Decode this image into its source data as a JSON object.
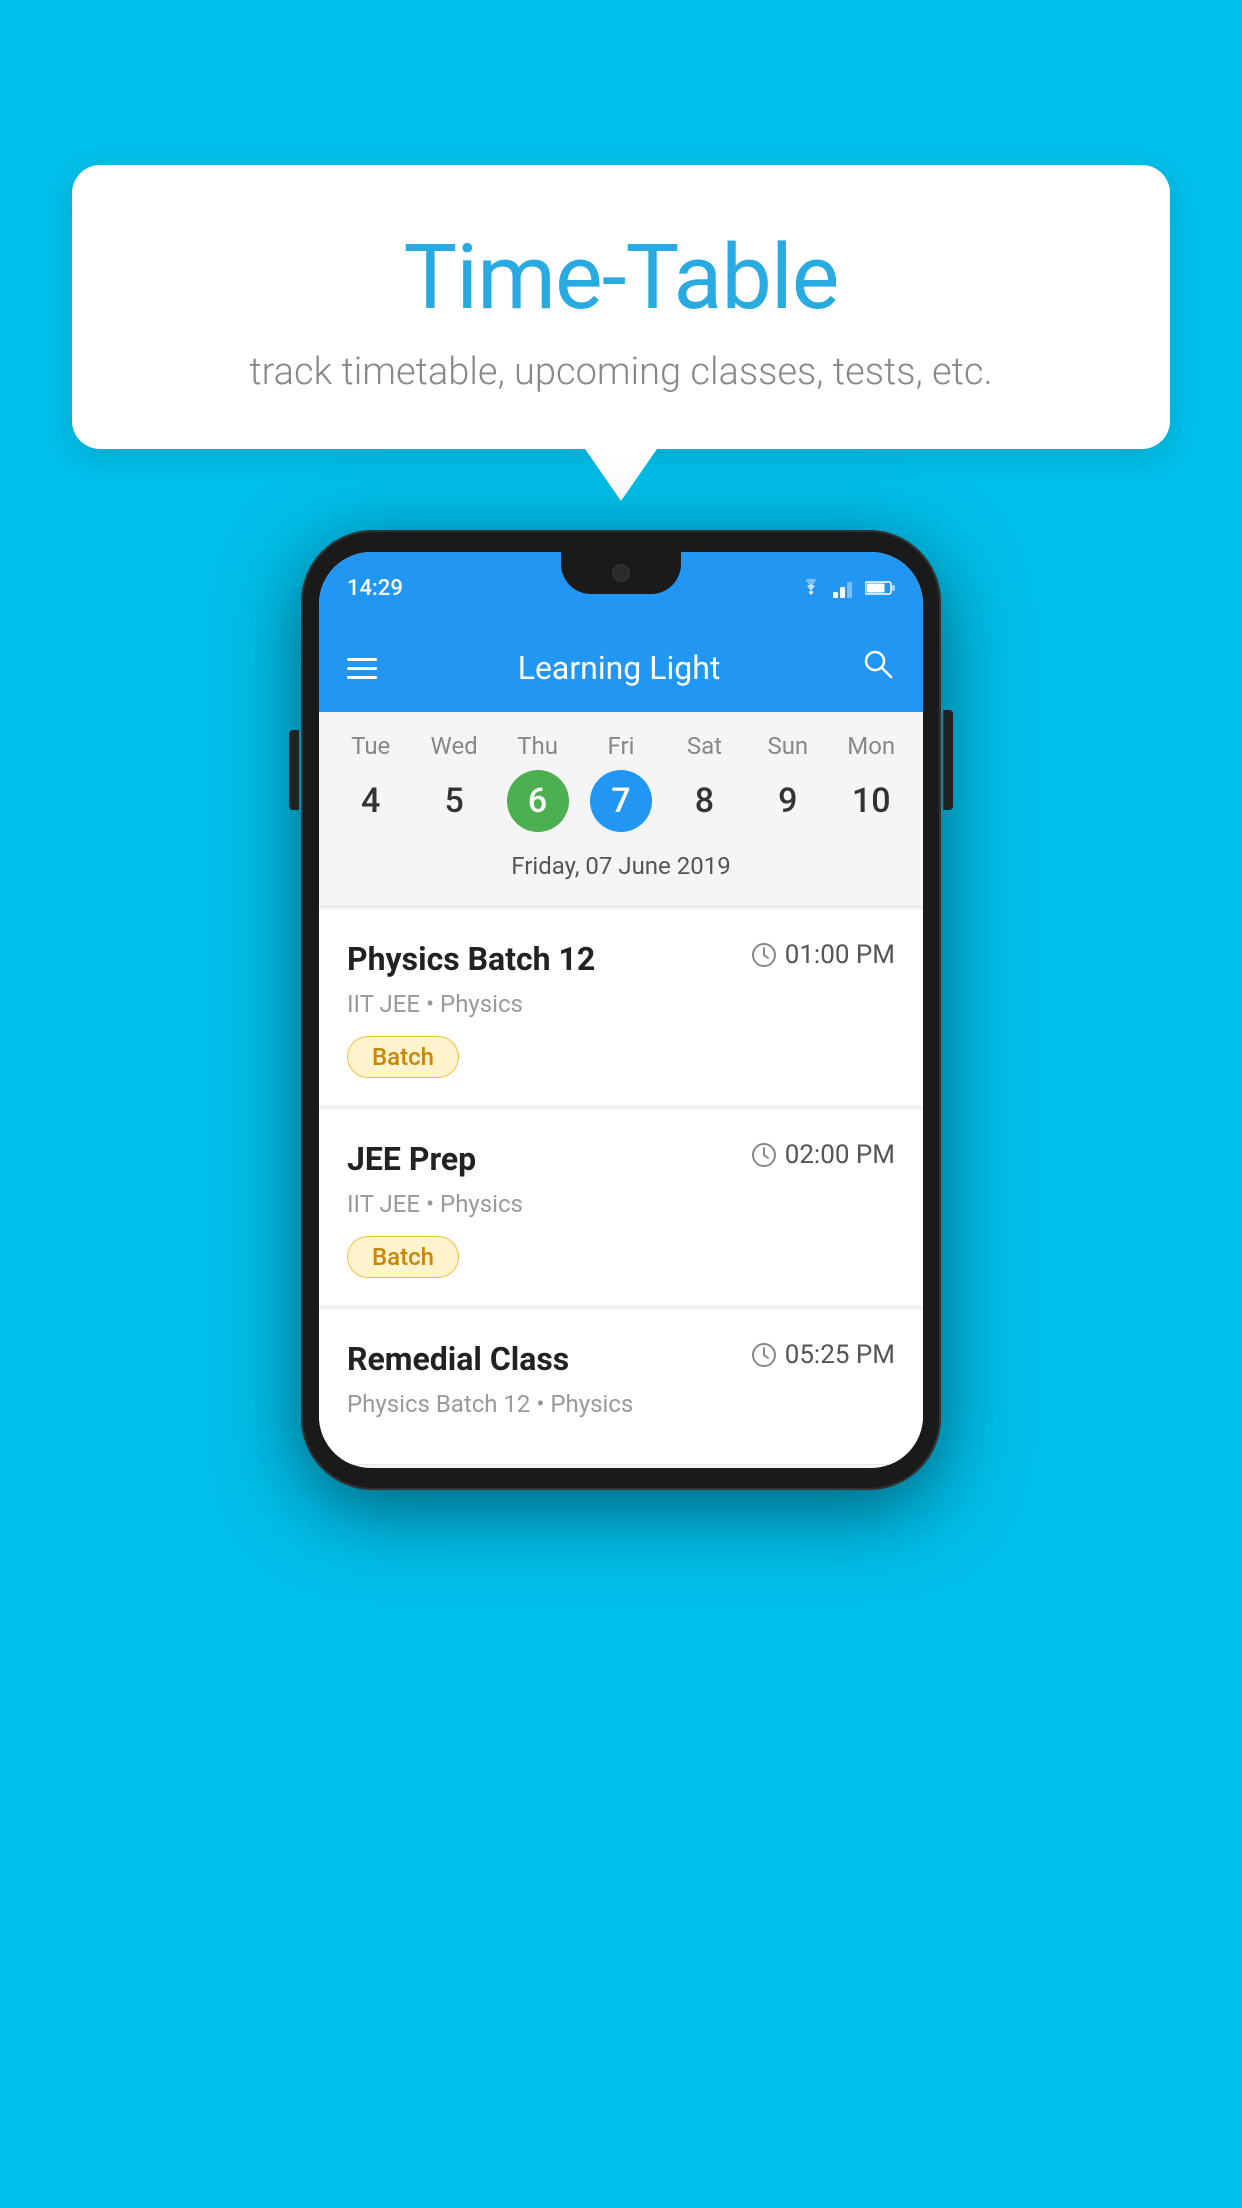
{
  "background_color": "#00BFEA",
  "speech_bubble": {
    "title": "Time-Table",
    "subtitle": "track timetable, upcoming classes, tests, etc."
  },
  "phone": {
    "status_bar": {
      "time": "14:29"
    },
    "app_bar": {
      "title": "Learning Light",
      "hamburger_label": "menu",
      "search_label": "search"
    },
    "calendar": {
      "selected_date_label": "Friday, 07 June 2019",
      "days": [
        {
          "name": "Tue",
          "num": "4",
          "state": "normal"
        },
        {
          "name": "Wed",
          "num": "5",
          "state": "normal"
        },
        {
          "name": "Thu",
          "num": "6",
          "state": "today"
        },
        {
          "name": "Fri",
          "num": "7",
          "state": "selected"
        },
        {
          "name": "Sat",
          "num": "8",
          "state": "normal"
        },
        {
          "name": "Sun",
          "num": "9",
          "state": "normal"
        },
        {
          "name": "Mon",
          "num": "10",
          "state": "normal"
        }
      ]
    },
    "classes": [
      {
        "title": "Physics Batch 12",
        "time": "01:00 PM",
        "subtitle": "IIT JEE • Physics",
        "badge": "Batch"
      },
      {
        "title": "JEE Prep",
        "time": "02:00 PM",
        "subtitle": "IIT JEE • Physics",
        "badge": "Batch"
      },
      {
        "title": "Remedial Class",
        "time": "05:25 PM",
        "subtitle": "Physics Batch 12 • Physics",
        "badge": ""
      }
    ]
  }
}
